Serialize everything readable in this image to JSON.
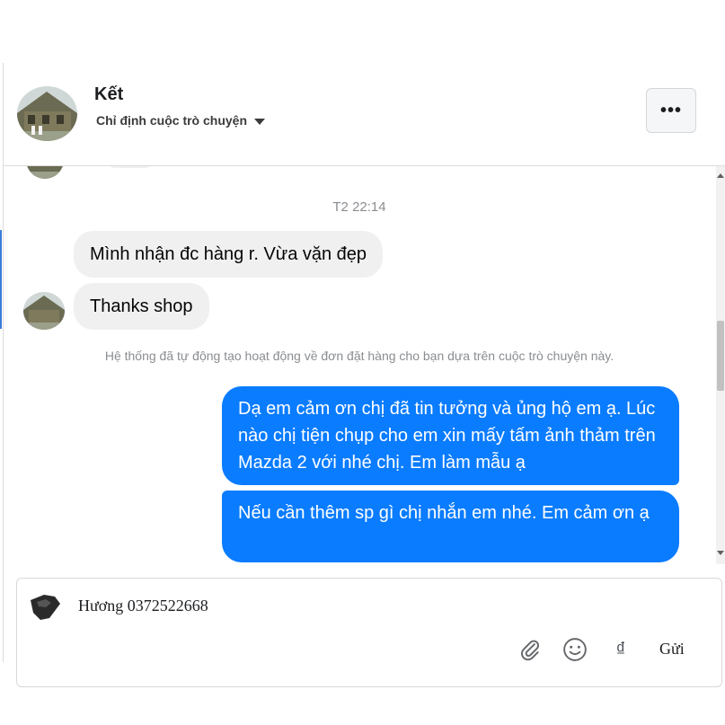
{
  "header": {
    "contact_name": "Kết",
    "assign_label": "Chỉ định cuộc trò chuyện",
    "more_label": "•••"
  },
  "conversation": {
    "timestamp": "T2 22:14",
    "incoming": [
      {
        "text": "Mình nhận đc hàng r. Vừa vặn đẹp"
      },
      {
        "text": "Thanks shop"
      }
    ],
    "system_note": "Hệ thống đã tự động tạo hoạt động về đơn đặt hàng cho bạn dựa trên cuộc trò chuyện này.",
    "outgoing": [
      {
        "text": "Dạ em cảm ơn chị đã tin tưởng và ủng hộ em ạ. Lúc nào chị tiện chụp cho em xin mấy tấm ảnh thảm trên Mazda 2 với nhé chị. Em làm mẫu ạ"
      },
      {
        "text": "Nếu cần thêm sp gì chị nhắn em nhé. Em cảm ơn ạ"
      }
    ]
  },
  "composer": {
    "input_value": "Hương 0372522668",
    "currency_symbol": "₫",
    "send_label": "Gửi",
    "icons": [
      "paperclip-icon",
      "emoji-icon",
      "currency-icon"
    ]
  },
  "colors": {
    "outgoing_bubble": "#0a7cff",
    "incoming_bubble": "#f0f0f0",
    "muted_text": "#8a8d91"
  }
}
